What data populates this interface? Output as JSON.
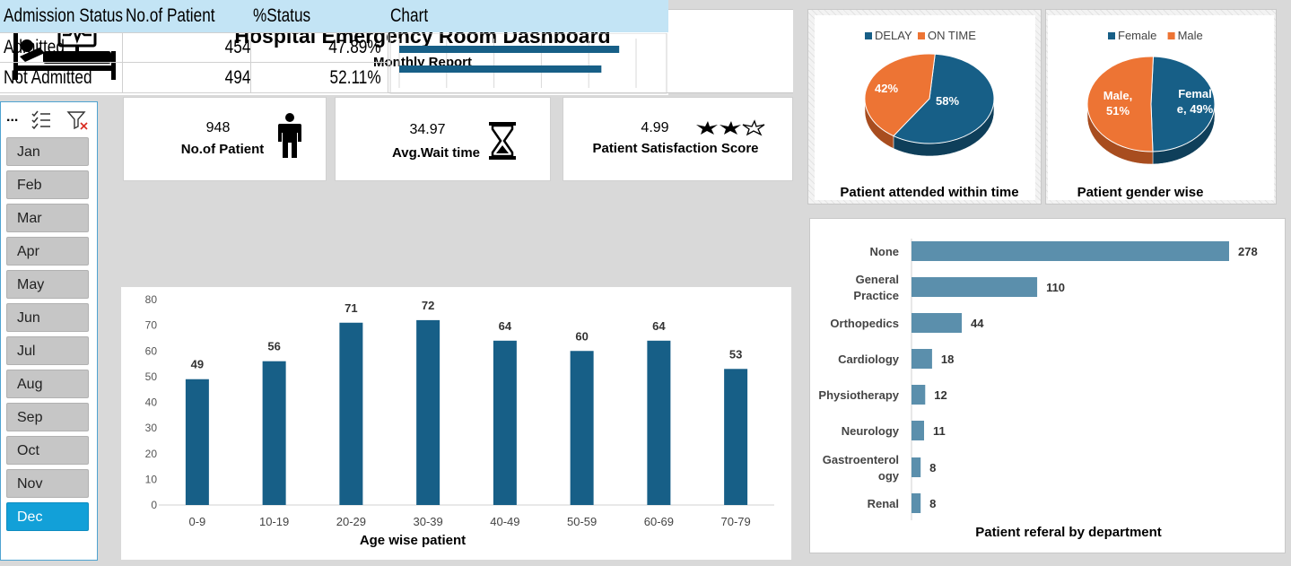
{
  "header": {
    "title": "Hospital Emergency Room Dashboard",
    "subtitle": "Monthly Report"
  },
  "slicer": {
    "more_label": "...",
    "months": [
      "Jan",
      "Feb",
      "Mar",
      "Apr",
      "May",
      "Jun",
      "Jul",
      "Aug",
      "Sep",
      "Oct",
      "Nov",
      "Dec"
    ],
    "selected": "Dec"
  },
  "kpis": {
    "patients": {
      "value": "948",
      "label": "No.of Patient"
    },
    "wait": {
      "value": "34.97",
      "label": "Avg.Wait time"
    },
    "satisfaction": {
      "value": "4.99",
      "label": "Patient Satisfaction Score"
    }
  },
  "admission": {
    "headers": [
      "Admission Status",
      "No.of Patient",
      "%Status",
      "Chart"
    ],
    "rows": [
      {
        "status": "Admitted",
        "count": "454",
        "pct": "47.89%"
      },
      {
        "status": "Not Admitted",
        "count": "494",
        "pct": "52.11%"
      }
    ]
  },
  "chart_data": [
    {
      "type": "bar",
      "title": "",
      "xlabel": "Age wise patient",
      "ylabel": "",
      "categories": [
        "0-9",
        "10-19",
        "20-29",
        "30-39",
        "40-49",
        "50-59",
        "60-69",
        "70-79"
      ],
      "values": [
        49,
        56,
        71,
        72,
        64,
        60,
        64,
        53
      ],
      "ylim": [
        0,
        80
      ],
      "yticks": [
        0,
        10,
        20,
        30,
        40,
        50,
        60,
        70,
        80
      ],
      "color": "#175f87"
    },
    {
      "type": "pie",
      "title": "Patient attended within time",
      "series": [
        {
          "name": "DELAY",
          "value": 58,
          "label": "58%",
          "color": "#175f87"
        },
        {
          "name": "ON TIME",
          "value": 42,
          "label": "42%",
          "color": "#ed7434"
        }
      ]
    },
    {
      "type": "pie",
      "title": "Patient gender wise",
      "series": [
        {
          "name": "Female",
          "value": 49,
          "label_lines": [
            "Femal",
            "e, 49%"
          ],
          "color": "#175f87"
        },
        {
          "name": "Male",
          "value": 51,
          "label_lines": [
            "Male,",
            "51%"
          ],
          "color": "#ed7434"
        }
      ]
    },
    {
      "type": "bar",
      "orientation": "horizontal",
      "title": "Patient referal by department",
      "categories": [
        [
          "None"
        ],
        [
          "General",
          "Practice"
        ],
        [
          "Orthopedics"
        ],
        [
          "Cardiology"
        ],
        [
          "Physiotherapy"
        ],
        [
          "Neurology"
        ],
        [
          "Gastroenterol",
          "ogy"
        ],
        [
          "Renal"
        ]
      ],
      "values": [
        278,
        110,
        44,
        18,
        12,
        11,
        8,
        8
      ],
      "color": "#5b8fac"
    },
    {
      "type": "bar",
      "orientation": "horizontal",
      "title": "",
      "categories": [
        "Admitted",
        "Not Admitted"
      ],
      "values": [
        454,
        494
      ],
      "color": "#175f87"
    }
  ]
}
